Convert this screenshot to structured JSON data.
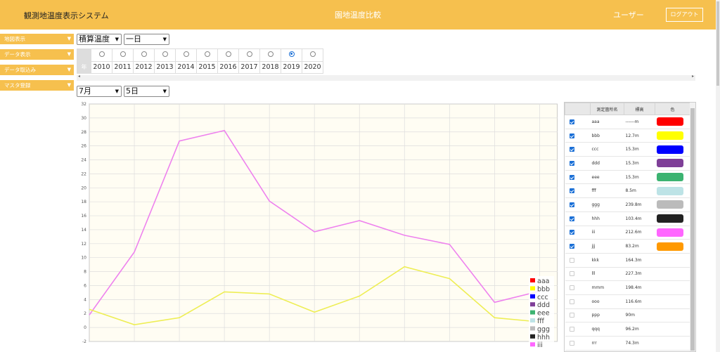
{
  "header": {
    "app_title": "観測地温度表示システム",
    "page_title": "園地温度比較",
    "user_label": "ユーザー",
    "logout_label": "ログアウト"
  },
  "sidebar": {
    "items": [
      {
        "label": "地図表示"
      },
      {
        "label": "データ表示"
      },
      {
        "label": "データ取込み"
      },
      {
        "label": "マスタ登録"
      }
    ]
  },
  "controls": {
    "mode": "積算温度",
    "period": "一日",
    "month": "7月",
    "day": "5日"
  },
  "years": {
    "header": "年",
    "list": [
      "2010",
      "2011",
      "2012",
      "2013",
      "2014",
      "2015",
      "2016",
      "2017",
      "2018",
      "2019",
      "2020"
    ],
    "selected": "2019"
  },
  "station_table": {
    "headers": [
      "",
      "測定箇所名",
      "標高",
      "色"
    ],
    "rows": [
      {
        "checked": true,
        "name": "aaa",
        "alt": "------m",
        "color": "#ff0000"
      },
      {
        "checked": true,
        "name": "bbb",
        "alt": "12.7m",
        "color": "#ffff00"
      },
      {
        "checked": true,
        "name": "ccc",
        "alt": "15.3m",
        "color": "#0000ff"
      },
      {
        "checked": true,
        "name": "ddd",
        "alt": "15.3m",
        "color": "#7f3f98"
      },
      {
        "checked": true,
        "name": "eee",
        "alt": "15.3m",
        "color": "#3cb371"
      },
      {
        "checked": true,
        "name": "fff",
        "alt": "8.5m",
        "color": "#bde3e6"
      },
      {
        "checked": true,
        "name": "ggg",
        "alt": "239.8m",
        "color": "#bbbbbb"
      },
      {
        "checked": true,
        "name": "hhh",
        "alt": "103.4m",
        "color": "#222222"
      },
      {
        "checked": true,
        "name": "iii",
        "alt": "212.6m",
        "color": "#ff66ff"
      },
      {
        "checked": true,
        "name": "jjj",
        "alt": "83.2m",
        "color": "#ff9900"
      },
      {
        "checked": false,
        "name": "kkk",
        "alt": "164.3m",
        "color": ""
      },
      {
        "checked": false,
        "name": "lll",
        "alt": "227.3m",
        "color": ""
      },
      {
        "checked": false,
        "name": "mmm",
        "alt": "198.4m",
        "color": ""
      },
      {
        "checked": false,
        "name": "ooo",
        "alt": "116.6m",
        "color": ""
      },
      {
        "checked": false,
        "name": "ppp",
        "alt": "90m",
        "color": ""
      },
      {
        "checked": false,
        "name": "qqq",
        "alt": "96.2m",
        "color": ""
      },
      {
        "checked": false,
        "name": "rrr",
        "alt": "74.3m",
        "color": ""
      }
    ]
  },
  "chart_data": {
    "type": "line",
    "ylim": [
      -2,
      32
    ],
    "yticks": [
      -2,
      0,
      2,
      4,
      6,
      8,
      10,
      12,
      14,
      16,
      18,
      20,
      22,
      24,
      26,
      28,
      30,
      32
    ],
    "x": [
      0,
      1,
      2,
      3,
      4,
      5,
      6,
      7,
      8,
      9,
      10
    ],
    "grid": true,
    "series": [
      {
        "name": "iii",
        "color": "#ee82ee",
        "values": [
          1.8,
          10.8,
          26.7,
          28.2,
          18.1,
          13.7,
          15.3,
          13.2,
          11.9,
          3.6,
          5.2
        ]
      },
      {
        "name": "bbb",
        "color": "#eeee55",
        "values": [
          2.6,
          0.4,
          1.4,
          5.1,
          4.8,
          2.2,
          4.5,
          8.7,
          7.0,
          1.4,
          0.8
        ]
      }
    ],
    "legend": {
      "position": "bottom-right",
      "entries": [
        {
          "name": "aaa",
          "color": "#ff0000"
        },
        {
          "name": "bbb",
          "color": "#ffff00"
        },
        {
          "name": "ccc",
          "color": "#0000ff"
        },
        {
          "name": "ddd",
          "color": "#7f3f98"
        },
        {
          "name": "eee",
          "color": "#3cb371"
        },
        {
          "name": "fff",
          "color": "#bde3e6"
        },
        {
          "name": "ggg",
          "color": "#bbbbbb"
        },
        {
          "name": "hhh",
          "color": "#222222"
        },
        {
          "name": "iii",
          "color": "#ff66ff"
        }
      ]
    }
  }
}
